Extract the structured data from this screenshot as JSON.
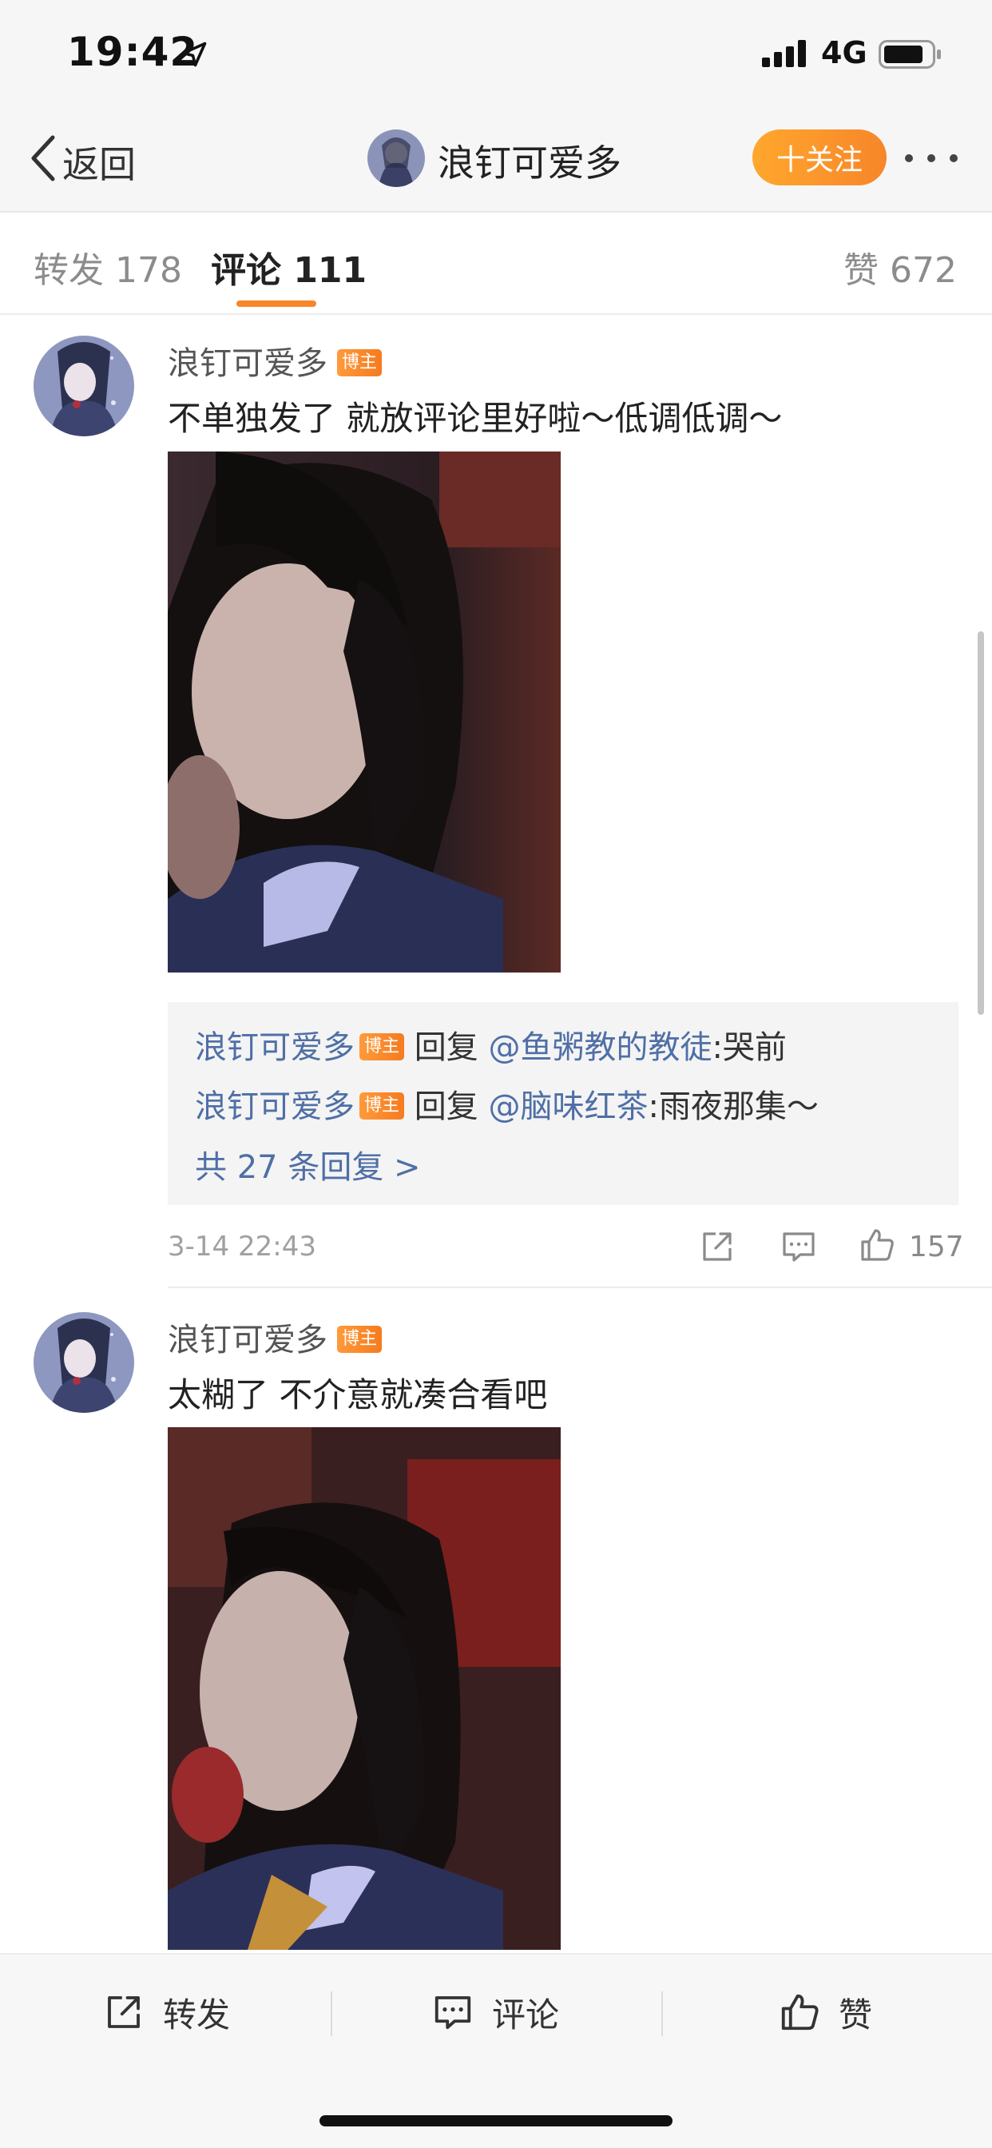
{
  "status": {
    "time": "19:42",
    "network": "4G"
  },
  "nav": {
    "back_label": "返回",
    "title": "浪钉可爱多",
    "follow_label": "十关注"
  },
  "tabs": {
    "repost": "转发 178",
    "comment": "评论 111",
    "like": "赞 672"
  },
  "comments": [
    {
      "author": "浪钉可爱多",
      "badge": "博主",
      "text": "不单独发了 就放评论里好啦～低调低调～",
      "replies": [
        {
          "author": "浪钉可爱多",
          "badge": "博主",
          "verb": " 回复 ",
          "target": "@鱼粥教的教徒",
          "content": ":哭前"
        },
        {
          "author": "浪钉可爱多",
          "badge": "博主",
          "verb": " 回复 ",
          "target": "@脑味红茶",
          "content": ":雨夜那集～"
        }
      ],
      "reply_total": "共 27 条回复 >",
      "time": "3-14 22:43",
      "likes": "157"
    },
    {
      "author": "浪钉可爱多",
      "badge": "博主",
      "text": "太糊了 不介意就凑合看吧"
    }
  ],
  "bottom_bar": {
    "repost": "转发",
    "comment": "评论",
    "like": "赞"
  },
  "colors": {
    "accent": "#f7862a",
    "link": "#4f6fa6",
    "badge": "#f57b20"
  },
  "icons": [
    "location-arrow-icon",
    "signal-icon",
    "battery-icon",
    "chevron-left-icon",
    "more-icon",
    "share-icon",
    "comment-icon",
    "thumbs-up-icon"
  ]
}
